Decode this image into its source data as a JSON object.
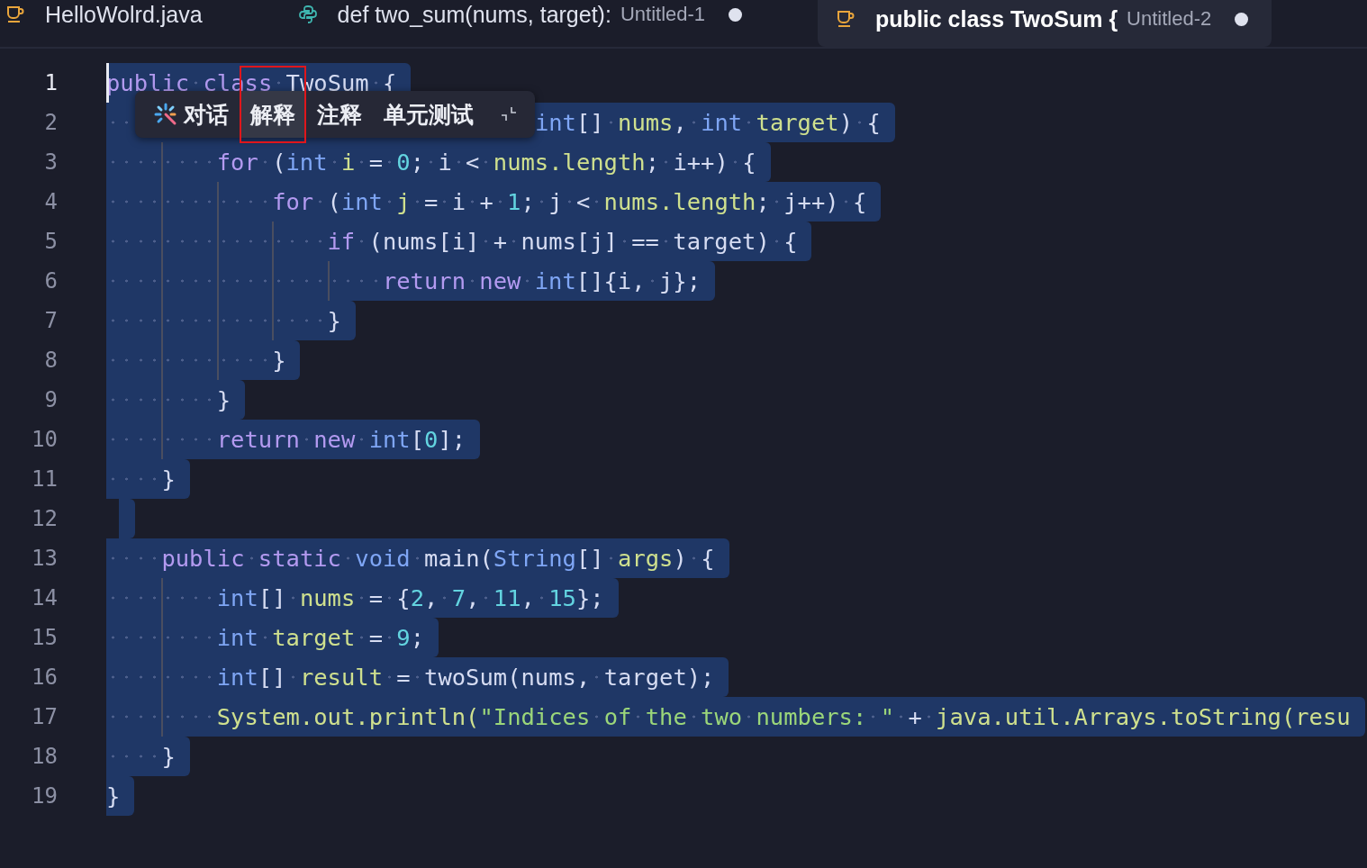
{
  "tabs": [
    {
      "title": "HelloWolrd.java",
      "selected": false,
      "modified": false
    },
    {
      "title": "def two_sum(nums, target):",
      "description": "Untitled-1",
      "selected": false,
      "modified": true
    },
    {
      "title": "public class TwoSum {",
      "description": "Untitled-2",
      "selected": true,
      "modified": true
    }
  ],
  "editor": {
    "lines": [
      {
        "number": "1",
        "current": true,
        "tokens": [
          {
            "kind": "kw",
            "text": "public "
          },
          {
            "kind": "kw",
            "text": "class "
          },
          {
            "kind": "p",
            "text": "TwoSum {"
          }
        ]
      },
      {
        "number": "2",
        "current": false,
        "covered_start": true,
        "tokens": [
          {
            "kind": "type",
            "text": "  int"
          },
          {
            "kind": "p",
            "text": "[] "
          },
          {
            "kind": "var",
            "text": "nums"
          },
          {
            "kind": "p",
            "text": ", "
          },
          {
            "kind": "type",
            "text": "int "
          },
          {
            "kind": "var",
            "text": "target"
          },
          {
            "kind": "p",
            "text": ") {"
          }
        ]
      },
      {
        "number": "3",
        "current": false,
        "tokens": [
          {
            "kind": "kw",
            "text": "        for "
          },
          {
            "kind": "p",
            "text": "("
          },
          {
            "kind": "type",
            "text": "int "
          },
          {
            "kind": "var",
            "text": "i "
          },
          {
            "kind": "p",
            "text": "= "
          },
          {
            "kind": "num",
            "text": "0"
          },
          {
            "kind": "p",
            "text": "; i < "
          },
          {
            "kind": "var",
            "text": "nums.length"
          },
          {
            "kind": "p",
            "text": "; i++) {"
          }
        ]
      },
      {
        "number": "4",
        "current": false,
        "tokens": [
          {
            "kind": "kw",
            "text": "            for "
          },
          {
            "kind": "p",
            "text": "("
          },
          {
            "kind": "type",
            "text": "int "
          },
          {
            "kind": "var",
            "text": "j "
          },
          {
            "kind": "p",
            "text": "= i + "
          },
          {
            "kind": "num",
            "text": "1"
          },
          {
            "kind": "p",
            "text": "; j < "
          },
          {
            "kind": "var",
            "text": "nums.length"
          },
          {
            "kind": "p",
            "text": "; j++) {"
          }
        ]
      },
      {
        "number": "5",
        "current": false,
        "tokens": [
          {
            "kind": "kw",
            "text": "                if "
          },
          {
            "kind": "p",
            "text": "(nums[i] + nums[j] == target) {"
          }
        ]
      },
      {
        "number": "6",
        "current": false,
        "tokens": [
          {
            "kind": "kw",
            "text": "                    return "
          },
          {
            "kind": "kw",
            "text": "new "
          },
          {
            "kind": "type",
            "text": "int"
          },
          {
            "kind": "p",
            "text": "[]{i, j};"
          }
        ]
      },
      {
        "number": "7",
        "current": false,
        "tokens": [
          {
            "kind": "p",
            "text": "                }"
          }
        ]
      },
      {
        "number": "8",
        "current": false,
        "tokens": [
          {
            "kind": "p",
            "text": "            }"
          }
        ]
      },
      {
        "number": "9",
        "current": false,
        "tokens": [
          {
            "kind": "p",
            "text": "        }"
          }
        ]
      },
      {
        "number": "10",
        "current": false,
        "tokens": [
          {
            "kind": "kw",
            "text": "        return "
          },
          {
            "kind": "kw",
            "text": "new "
          },
          {
            "kind": "type",
            "text": "int"
          },
          {
            "kind": "p",
            "text": "["
          },
          {
            "kind": "num",
            "text": "0"
          },
          {
            "kind": "p",
            "text": "];"
          }
        ]
      },
      {
        "number": "11",
        "current": false,
        "tokens": [
          {
            "kind": "p",
            "text": "    }"
          }
        ]
      },
      {
        "number": "12",
        "current": false
      },
      {
        "number": "13",
        "current": false,
        "tokens": [
          {
            "kind": "kw",
            "text": "    public "
          },
          {
            "kind": "kw",
            "text": "static "
          },
          {
            "kind": "type",
            "text": "void "
          },
          {
            "kind": "p",
            "text": "main("
          },
          {
            "kind": "type",
            "text": "String"
          },
          {
            "kind": "p",
            "text": "[] "
          },
          {
            "kind": "var",
            "text": "args"
          },
          {
            "kind": "p",
            "text": ") {"
          }
        ]
      },
      {
        "number": "14",
        "current": false,
        "tokens": [
          {
            "kind": "type",
            "text": "        int"
          },
          {
            "kind": "p",
            "text": "[] "
          },
          {
            "kind": "var",
            "text": "nums "
          },
          {
            "kind": "p",
            "text": "= {"
          },
          {
            "kind": "num",
            "text": "2"
          },
          {
            "kind": "p",
            "text": ", "
          },
          {
            "kind": "num",
            "text": "7"
          },
          {
            "kind": "p",
            "text": ", "
          },
          {
            "kind": "num",
            "text": "11"
          },
          {
            "kind": "p",
            "text": ", "
          },
          {
            "kind": "num",
            "text": "15"
          },
          {
            "kind": "p",
            "text": "};"
          }
        ]
      },
      {
        "number": "15",
        "current": false,
        "tokens": [
          {
            "kind": "type",
            "text": "        int "
          },
          {
            "kind": "var",
            "text": "target "
          },
          {
            "kind": "p",
            "text": "= "
          },
          {
            "kind": "num",
            "text": "9"
          },
          {
            "kind": "p",
            "text": ";"
          }
        ]
      },
      {
        "number": "16",
        "current": false,
        "tokens": [
          {
            "kind": "type",
            "text": "        int"
          },
          {
            "kind": "p",
            "text": "[] "
          },
          {
            "kind": "var",
            "text": "result "
          },
          {
            "kind": "p",
            "text": "= twoSum(nums, target);"
          }
        ]
      },
      {
        "number": "17",
        "current": false,
        "tokens": [
          {
            "kind": "var",
            "text": "        System.out.println("
          },
          {
            "kind": "str",
            "text": "\"Indices of the two numbers: \""
          },
          {
            "kind": "p",
            "text": " + "
          },
          {
            "kind": "var",
            "text": "java.util.Arrays.toString(resu"
          }
        ]
      },
      {
        "number": "18",
        "current": false,
        "tokens": [
          {
            "kind": "p",
            "text": "    }"
          }
        ]
      },
      {
        "number": "19",
        "current": false,
        "tokens": [
          {
            "kind": "p",
            "text": "}"
          }
        ]
      }
    ]
  },
  "popup": {
    "items": [
      {
        "kind": "action",
        "label": "对话",
        "selected": false,
        "outlined": false
      },
      {
        "kind": "action",
        "label": "解释",
        "selected": true,
        "outlined": true
      },
      {
        "kind": "action",
        "label": "注释",
        "selected": false,
        "outlined": false
      },
      {
        "kind": "action",
        "label": "单元测试",
        "selected": false,
        "outlined": false
      },
      {
        "kind": "collapse"
      }
    ]
  }
}
